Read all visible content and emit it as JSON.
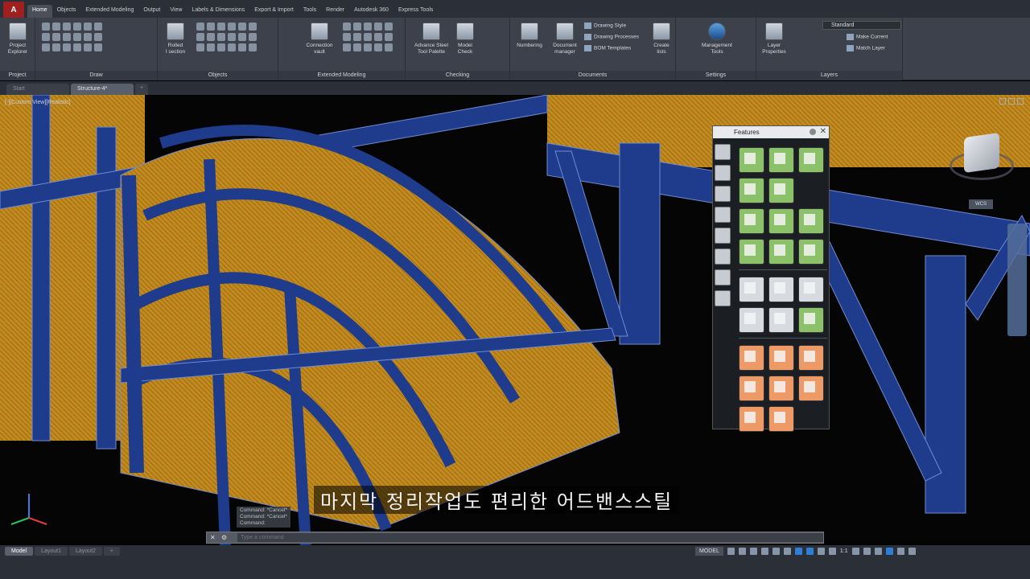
{
  "app": {
    "logo": "A"
  },
  "ribbon_tabs": [
    "Home",
    "Objects",
    "Extended Modeling",
    "Output",
    "View",
    "Labels & Dimensions",
    "Export & Import",
    "Tools",
    "Render",
    "Autodesk 360",
    "Express Tools"
  ],
  "panels": {
    "project": {
      "label": "Project",
      "btn": "Project\nExplorer"
    },
    "draw": {
      "label": "Draw"
    },
    "objects": {
      "label": "Objects",
      "btn": "Rolled\nI section"
    },
    "extended": {
      "label": "Extended Modeling",
      "btn": "Connection\nvault"
    },
    "checking": {
      "label": "Checking",
      "btn1": "Advance Steel\nTool Palette",
      "btn2": "Model\nCheck"
    },
    "documents": {
      "label": "Documents",
      "btn1": "Numbering",
      "btn2": "Document\nmanager",
      "btn3": "Create\nlists",
      "s1": "Drawing Style",
      "s2": "Drawing Processes",
      "s3": "BOM Templates"
    },
    "settings": {
      "label": "Settings",
      "btn": "Management\nTools"
    },
    "layers": {
      "label": "Layers",
      "btn": "Layer\nProperties",
      "layer_value": "Standard",
      "s1": "Make Current",
      "s2": "Match Layer"
    }
  },
  "file_tabs": [
    "Start",
    "Structure-4*",
    "+"
  ],
  "viewport": {
    "label": "[-][Custom View][Realistic]",
    "wcs": "WCS"
  },
  "features_palette": {
    "title": "Features",
    "close": "✕"
  },
  "command": {
    "history": [
      "Command: *Cancel*",
      "Command: *Cancel*",
      "Command:"
    ],
    "placeholder": "Type a command"
  },
  "subtitle": "마지막 정리작업도 편리한 어드밴스스틸",
  "layout_tabs": [
    "Model",
    "Layout1",
    "Layout2",
    "+"
  ],
  "status": {
    "model": "MODEL",
    "scale": "1:1"
  },
  "colors": {
    "steel": "#1e3b8c",
    "panel": "#c28a1e",
    "palette_green": "#8bc269",
    "palette_orange": "#ee9a66"
  }
}
